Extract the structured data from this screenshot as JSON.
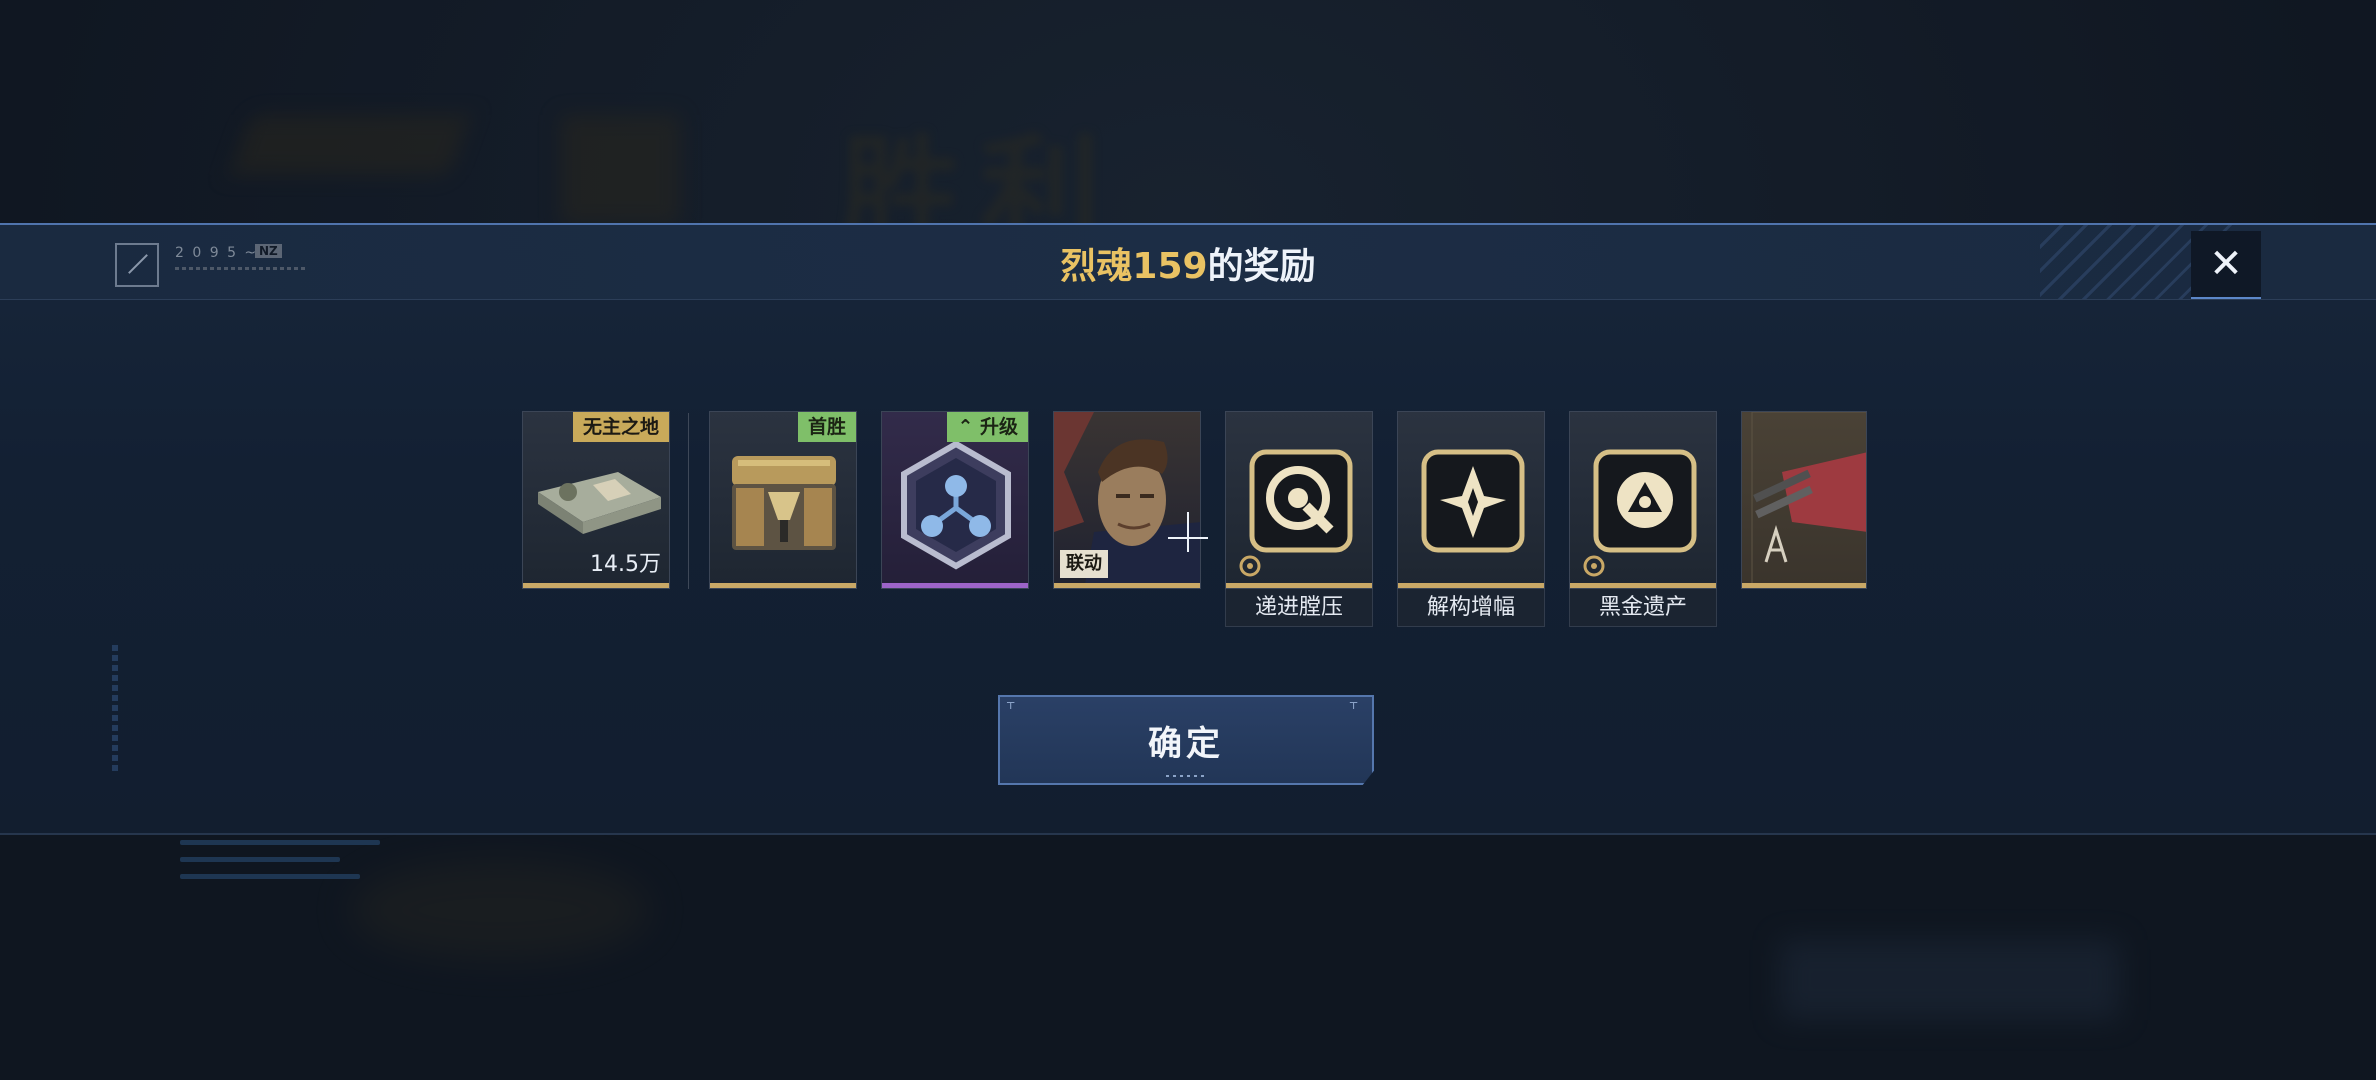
{
  "background": {
    "title_text": "胜利"
  },
  "modal": {
    "title_player": "烈魂159",
    "title_suffix": "的奖励",
    "close_icon": "close-icon",
    "logo": {
      "code": "2 0 9 5 ~",
      "tag": "NZ"
    }
  },
  "rewards": [
    {
      "id": "cash",
      "badge": "无主之地",
      "quantity": "14.5万",
      "icon": "cash-bundle-icon",
      "rarity_color": "#c9a866"
    },
    {
      "id": "chest",
      "badge": "首胜",
      "icon": "supply-chest-icon",
      "rarity_color": "#c9a866"
    },
    {
      "id": "upgrade",
      "badge": "升级",
      "icon": "molecule-hex-icon",
      "rarity_color": "#9d64c8"
    },
    {
      "id": "character",
      "tag": "联动",
      "icon": "character-portrait",
      "rarity_color": "#c9a866"
    },
    {
      "id": "skill1",
      "label": "递进膛压",
      "icon": "target-skill-icon",
      "rarity_color": "#c9a866"
    },
    {
      "id": "skill2",
      "label": "解构增幅",
      "icon": "shatter-skill-icon",
      "rarity_color": "#c9a866"
    },
    {
      "id": "skill3",
      "label": "黑金遗产",
      "icon": "triad-skill-icon",
      "rarity_color": "#c9a866"
    },
    {
      "id": "weapon",
      "icon": "weapon-blueprint-icon",
      "rarity_color": "#c9a866"
    }
  ],
  "confirm": {
    "label": "确定"
  }
}
